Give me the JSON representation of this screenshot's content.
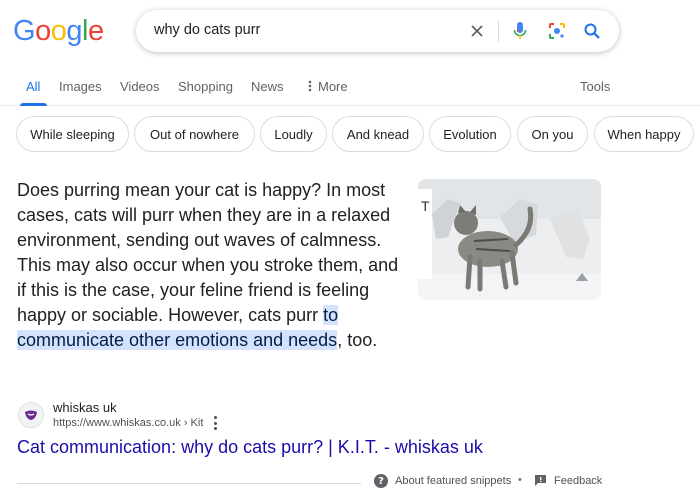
{
  "logo": {
    "letters": [
      "G",
      "o",
      "o",
      "g",
      "l",
      "e"
    ],
    "colors": [
      "#4285f4",
      "#ea4335",
      "#fbbc05",
      "#4285f4",
      "#34a853",
      "#ea4335"
    ]
  },
  "search": {
    "query": "why do cats purr",
    "icons": [
      "close-icon",
      "mic-icon",
      "lens-icon",
      "search-icon"
    ]
  },
  "tabs": [
    {
      "label": "All",
      "active": true
    },
    {
      "label": "Images"
    },
    {
      "label": "Videos"
    },
    {
      "label": "Shopping"
    },
    {
      "label": "News"
    },
    {
      "label": "More",
      "icon": "vertical-dots-icon"
    }
  ],
  "tools_label": "Tools",
  "chips": [
    "While sleeping",
    "Out of nowhere",
    "Loudly",
    "And knead",
    "Evolution",
    "On you",
    "When happy"
  ],
  "snippet": {
    "text_before": "Does purring mean your cat is happy? In most cases, cats will purr when they are in a relaxed environment, sending out waves of calmness. This may also occur when you stroke them, and if this is the case, your feline friend is feeling happy or sociable. However, cats purr ",
    "highlight": "to communicate other emotions and needs",
    "text_after": ", too.",
    "image_icon": "cat-photo"
  },
  "source": {
    "name": "whiskas uk",
    "url": "https://www.whiskas.co.uk › Kit",
    "favicon": "whiskas-favicon"
  },
  "result_title": "Cat communication: why do cats purr? | K.I.T. - whiskas uk",
  "footer": {
    "about": "About featured snippets",
    "separator": "•",
    "feedback": "Feedback"
  },
  "colors": {
    "link": "#1a0dab",
    "accent": "#1a73e8",
    "highlight_bg": "#d3e3fd"
  }
}
